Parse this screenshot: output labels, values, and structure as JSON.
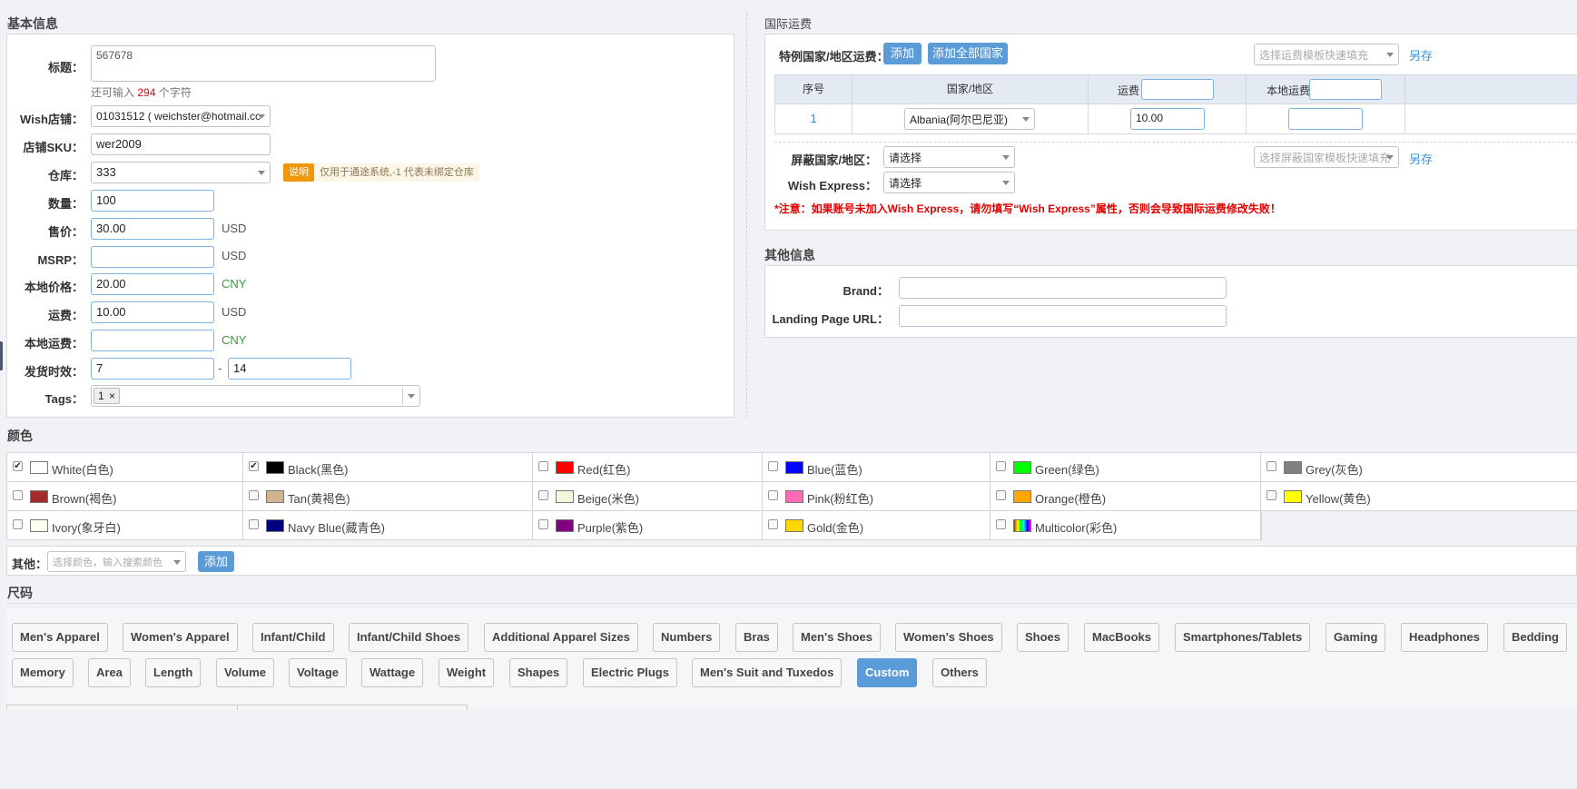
{
  "basic": {
    "section_title": "基本信息",
    "title_label": "标题：",
    "title_value": "567678",
    "chars_prefix": "还可输入",
    "chars_count": "294",
    "chars_suffix": "个字符",
    "shop_label": "Wish店铺：",
    "shop_value": "01031512 ( weichster@hotmail.cc",
    "sku_label": "店铺SKU：",
    "sku_value": "wer2009",
    "warehouse_label": "仓库：",
    "warehouse_value": "333",
    "note_badge": "说明",
    "note_text": "仅用于通途系统,-1 代表未绑定仓库",
    "qty_label": "数量：",
    "qty_value": "100",
    "price_label": "售价：",
    "price_value": "30.00",
    "price_unit": "USD",
    "msrp_label": "MSRP：",
    "msrp_value": "",
    "msrp_unit": "USD",
    "local_price_label": "本地价格：",
    "local_price_value": "20.00",
    "local_price_unit": "CNY",
    "shipping_label": "运费：",
    "shipping_value": "10.00",
    "shipping_unit": "USD",
    "local_shipping_label": "本地运费：",
    "local_shipping_value": "",
    "local_shipping_unit": "CNY",
    "ship_time_label": "发货时效：",
    "ship_time_min": "7",
    "ship_time_sep": "-",
    "ship_time_max": "14",
    "tags_label": "Tags：",
    "tag_1": "1",
    "tag_remove": "×"
  },
  "intl": {
    "section_title": "国际运费",
    "special_label": "特例国家/地区运费：",
    "add_btn": "添加",
    "add_all_btn": "添加全部国家",
    "template_placeholder": "选择运费模板快速填充",
    "save_as": "另存",
    "col_no": "序号",
    "col_country": "国家/地区",
    "col_shipping": "运费",
    "col_local_shipping": "本地运费",
    "row_no": "1",
    "row_country": "Albania(阿尔巴尼亚)",
    "row_shipping": "10.00",
    "row_local_shipping": "",
    "block_label": "屏蔽国家/地区：",
    "block_value": "请选择",
    "block_template_placeholder": "选择屏蔽国家模板快速填充",
    "express_label": "Wish Express：",
    "express_value": "请选择",
    "warning": "*注意：如果账号未加入Wish Express，请勿填写“Wish Express”属性，否则会导致国际运费修改失败！",
    "save_as_2": "另存"
  },
  "other": {
    "section_title": "其他信息",
    "brand_label": "Brand：",
    "brand_value": "",
    "landing_label": "Landing Page URL：",
    "landing_value": ""
  },
  "colors": {
    "section_title": "颜色",
    "items": [
      {
        "label": "White(白色)",
        "hex": "#ffffff",
        "checked": true
      },
      {
        "label": "Black(黑色)",
        "hex": "#000000",
        "checked": true
      },
      {
        "label": "Red(红色)",
        "hex": "#ff0000",
        "checked": false
      },
      {
        "label": "Blue(蓝色)",
        "hex": "#0000ff",
        "checked": false
      },
      {
        "label": "Green(绿色)",
        "hex": "#00ff00",
        "checked": false
      },
      {
        "label": "Grey(灰色)",
        "hex": "#808080",
        "checked": false
      },
      {
        "label": "Brown(褐色)",
        "hex": "#a52a2a",
        "checked": false
      },
      {
        "label": "Tan(黄褐色)",
        "hex": "#d2b48c",
        "checked": false
      },
      {
        "label": "Beige(米色)",
        "hex": "#f5f5dc",
        "checked": false
      },
      {
        "label": "Pink(粉红色)",
        "hex": "#ff69b4",
        "checked": false
      },
      {
        "label": "Orange(橙色)",
        "hex": "#ffa500",
        "checked": false
      },
      {
        "label": "Yellow(黄色)",
        "hex": "#ffff00",
        "checked": false
      },
      {
        "label": "Ivory(象牙白)",
        "hex": "#fffff0",
        "checked": false
      },
      {
        "label": "Navy Blue(藏青色)",
        "hex": "#000080",
        "checked": false
      },
      {
        "label": "Purple(紫色)",
        "hex": "#800080",
        "checked": false
      },
      {
        "label": "Gold(金色)",
        "hex": "#ffd700",
        "checked": false
      },
      {
        "label": "Multicolor(彩色)",
        "hex": "multicolor",
        "checked": false
      }
    ],
    "other_label": "其他：",
    "other_placeholder": "选择颜色，输入搜索颜色",
    "other_add_btn": "添加"
  },
  "sizes": {
    "section_title": "尺码",
    "row1": [
      "Men's Apparel",
      "Women's Apparel",
      "Infant/Child",
      "Infant/Child Shoes",
      "Additional Apparel Sizes",
      "Numbers",
      "Bras",
      "Men's Shoes",
      "Women's Shoes",
      "Shoes",
      "MacBooks",
      "Smartphones/Tablets",
      "Gaming",
      "Headphones",
      "Bedding"
    ],
    "row2": [
      "Memory",
      "Area",
      "Length",
      "Volume",
      "Voltage",
      "Wattage",
      "Weight",
      "Shapes",
      "Electric Plugs",
      "Men's Suit and Tuxedos",
      "Custom",
      "Others"
    ],
    "active": "Custom"
  }
}
